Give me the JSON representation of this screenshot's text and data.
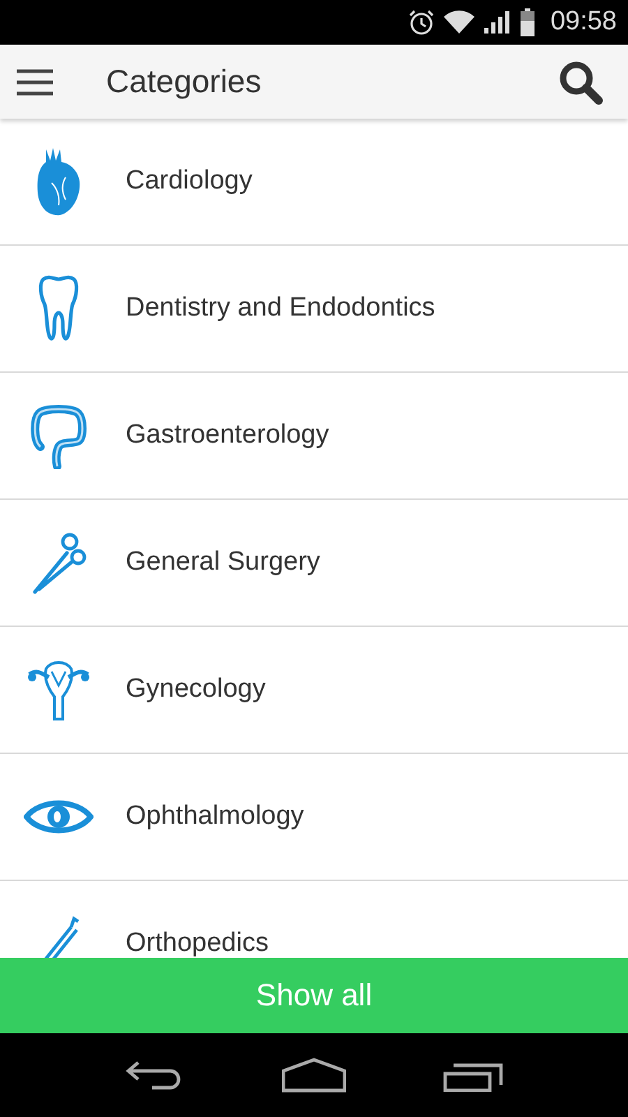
{
  "status_bar": {
    "time": "09:58"
  },
  "app_bar": {
    "title": "Categories"
  },
  "categories": [
    {
      "label": "Cardiology"
    },
    {
      "label": "Dentistry and Endodontics"
    },
    {
      "label": "Gastroenterology"
    },
    {
      "label": "General Surgery"
    },
    {
      "label": "Gynecology"
    },
    {
      "label": "Ophthalmology"
    },
    {
      "label": "Orthopedics"
    }
  ],
  "footer_button": {
    "label": "Show all"
  }
}
